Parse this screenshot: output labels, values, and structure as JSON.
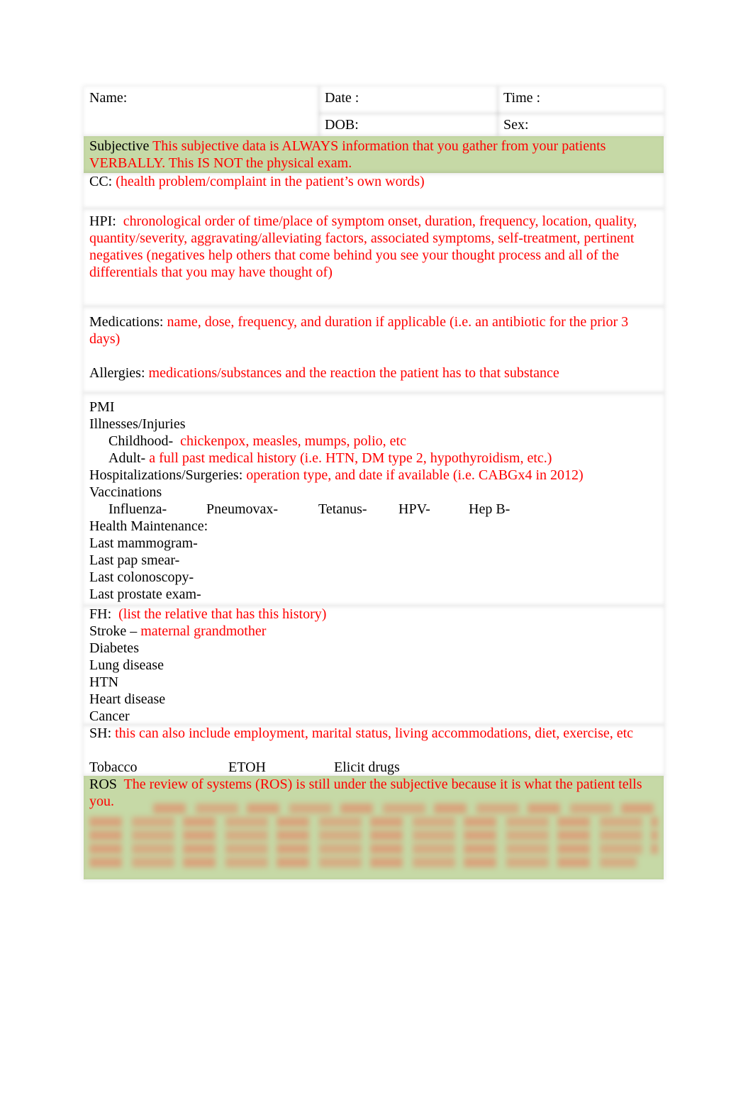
{
  "header": {
    "name_label": "Name:",
    "date_label": "Date :",
    "time_label": "Time :",
    "dob_label": "DOB:",
    "sex_label": "Sex:"
  },
  "subjective": {
    "label": "Subjective",
    "note": "This subjective data is ALWAYS information that you gather from your patients VERBALLY.   This IS NOT the physical exam."
  },
  "cc": {
    "label": "CC:",
    "note": "(health problem/complaint in the patient’s own words)"
  },
  "hpi": {
    "label": "HPI:",
    "note": "chronological order of time/place of symptom onset, duration, frequency, location, quality, quantity/severity, aggravating/alleviating factors, associated symptoms, self-treatment, pertinent negatives (negatives help others that come behind you see your thought process and all of the differentials that you may have thought of)"
  },
  "medications": {
    "label": "Medications:",
    "note": "name, dose, frequency, and duration if applicable (i.e. an antibiotic for the prior 3 days)"
  },
  "allergies": {
    "label": "Allergies:",
    "note": "medications/substances and the reaction the patient has to that substance"
  },
  "pmi": {
    "label": "PMI",
    "illnesses_label": "Illnesses/Injuries",
    "childhood_label": "Childhood-",
    "childhood_note": "chickenpox, measles, mumps, polio, etc",
    "adult_label": "Adult-",
    "adult_note": "a full past medical history (i.e. HTN, DM type 2, hypothyroidism, etc.)",
    "hospitalizations_label": "Hospitalizations/Surgeries:",
    "hospitalizations_note": "operation type, and date if available (i.e. CABGx4 in 2012)",
    "vaccinations_label": "Vaccinations",
    "vaccines": [
      "Influenza-",
      "Pneumovax-",
      "Tetanus-",
      "HPV-",
      "Hep B-"
    ],
    "health_maintenance_label": "Health Maintenance:",
    "health_items": [
      "Last mammogram-",
      "Last pap smear-",
      "Last colonoscopy-",
      "Last prostate exam-"
    ]
  },
  "fh": {
    "label": "FH:",
    "note": "(list the relative that has this history)",
    "items": [
      {
        "label": "Stroke –",
        "note": "maternal grandmother"
      },
      {
        "label": "Diabetes",
        "note": ""
      },
      {
        "label": "Lung disease",
        "note": ""
      },
      {
        "label": "HTN",
        "note": ""
      },
      {
        "label": "Heart disease",
        "note": ""
      },
      {
        "label": "Cancer",
        "note": ""
      }
    ]
  },
  "sh": {
    "label": "SH:",
    "note": "this can also include employment, marital status, living accommodations, diet, exercise, etc",
    "items": [
      "Tobacco",
      "ETOH",
      "Elicit drugs"
    ]
  },
  "ros": {
    "label": "ROS",
    "note": "The review of systems (ROS) is still under the subjective because it is what the patient tells you.",
    "obscured": true
  },
  "colors": {
    "instruction_text": "#ff0000",
    "highlight_green": "#c6d9a6",
    "body_text": "#000000"
  }
}
